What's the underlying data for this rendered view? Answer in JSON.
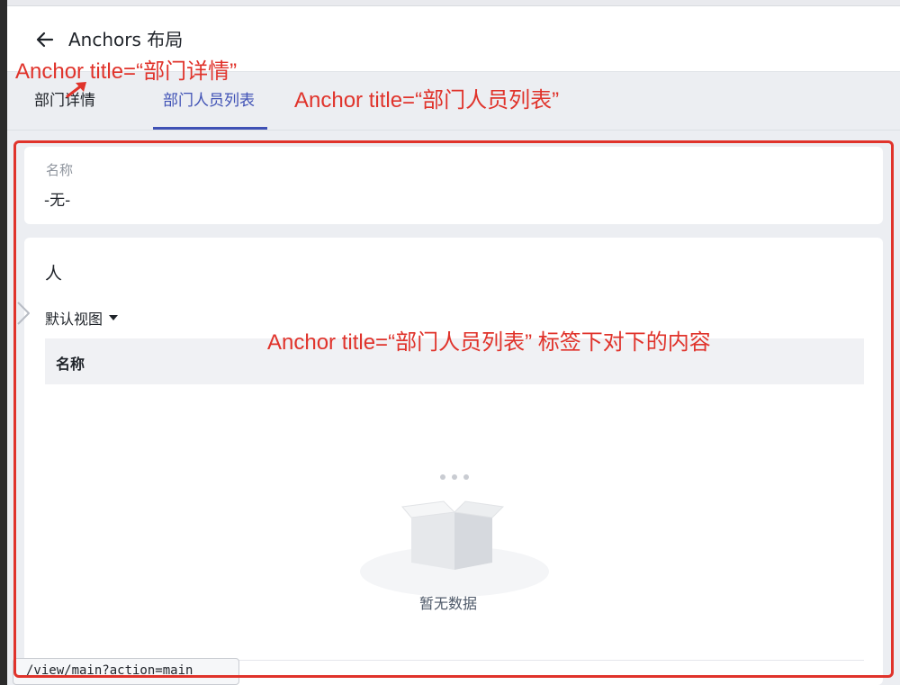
{
  "header": {
    "title": "Anchors 布局"
  },
  "tabs": [
    {
      "label": "部门详情",
      "active": false
    },
    {
      "label": "部门人员列表",
      "active": true
    }
  ],
  "name_card": {
    "label": "名称",
    "value": "-无-"
  },
  "people_card": {
    "title": "人",
    "view_label": "默认视图",
    "columns": [
      "名称"
    ],
    "empty_text": "暂无数据"
  },
  "status_url": "/view/main?action=main",
  "annotations": [
    "Anchor title=“部门详情”",
    "Anchor title=“部门人员列表”",
    "Anchor  title=“部门人员列表” 标签下对下的内容"
  ],
  "colors": {
    "accent": "#3f51b5",
    "annotation_red": "#e0332b",
    "page_bg": "#eceef2"
  },
  "icons": [
    "back-arrow-icon",
    "chevron-right-icon",
    "caret-down-icon",
    "empty-box-icon"
  ]
}
